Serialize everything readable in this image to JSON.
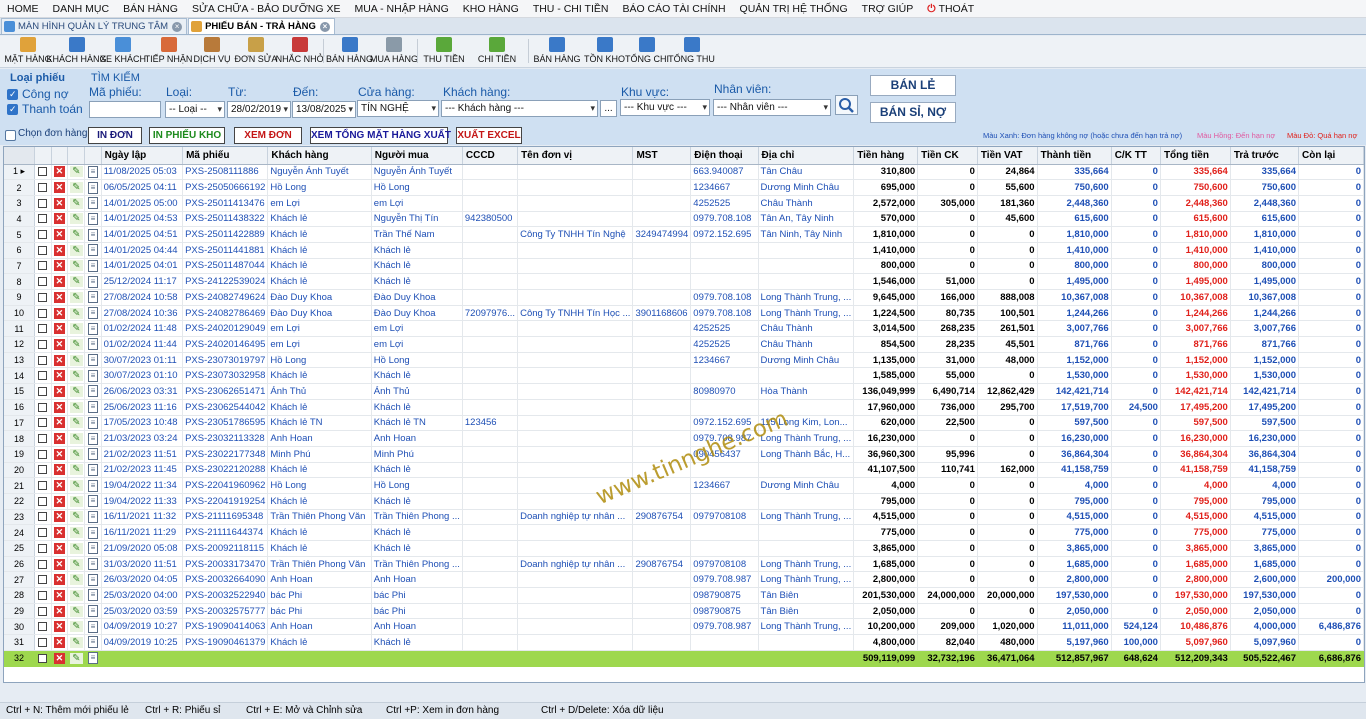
{
  "menu": [
    "HOME",
    "DANH MỤC",
    "BÁN HÀNG",
    "SỬA CHỮA - BẢO DƯỠNG XE",
    "MUA - NHẬP HÀNG",
    "KHO HÀNG",
    "THU - CHI TIỀN",
    "BÁO CÁO TÀI CHÍNH",
    "QUẢN TRỊ HỆ THỐNG",
    "TRỢ GIÚP",
    "THOÁT"
  ],
  "tabs": [
    "MÀN HÌNH QUẢN LÝ TRUNG TÂM",
    "PHIẾU BÁN - TRẢ HÀNG"
  ],
  "toolbar": [
    {
      "label": "MẶT HÀNG",
      "icon": "box-icon"
    },
    {
      "label": "KHÁCH HÀNG",
      "icon": "customer-icon"
    },
    {
      "label": "XE KHÁCH",
      "icon": "car-icon"
    },
    {
      "label": "TIẾP NHẬN",
      "icon": "reception-icon"
    },
    {
      "label": "DỊCH VỤ",
      "icon": "tools-icon"
    },
    {
      "label": "ĐƠN SỬA",
      "icon": "repair-order-icon"
    },
    {
      "label": "NHẮC NHỞ",
      "icon": "reminder-icon"
    },
    {
      "label": "BÁN HÀNG",
      "icon": "sales-icon"
    },
    {
      "label": "MUA HÀNG",
      "icon": "purchase-icon"
    },
    {
      "label": "THU TIỀN",
      "icon": "money-in-icon"
    },
    {
      "label": "CHI TIỀN",
      "icon": "money-out-icon"
    },
    {
      "label": "BÁN HÀNG",
      "icon": "sales-report-icon"
    },
    {
      "label": "TỒN KHO",
      "icon": "inventory-icon"
    },
    {
      "label": "TỔNG CHI",
      "icon": "total-expense-icon"
    },
    {
      "label": "TỔNG THU",
      "icon": "total-income-icon"
    }
  ],
  "filter": {
    "loai_phieu": "Loại phiếu",
    "tim_kiem": "TÌM KIẾM",
    "cong_no": "Công nợ",
    "thanh_toan": "Thanh toán",
    "ma_phieu_label": "Mã phiếu:",
    "loai_label": "Loại:",
    "tu_label": "Từ:",
    "den_label": "Đến:",
    "cua_hang_label": "Cửa hàng:",
    "khach_hang_label": "Khách hàng:",
    "khu_vuc_label": "Khu vực:",
    "nhan_vien_label": "Nhân viên:",
    "loai_value": "-- Loại --",
    "tu_value": "28/02/2019",
    "den_value": "13/08/2025",
    "cua_hang_value": "TÍN NGHỆ",
    "khach_hang_value": "--- Khách hàng ---",
    "khu_vuc_value": "--- Khu vực ---",
    "nhan_vien_value": "--- Nhân viên ---",
    "more_value": "...",
    "ban_le": "BÁN LẺ",
    "ban_si_no": "BÁN SỈ, NỢ",
    "chon_don_hang": "Chọn đơn hàng",
    "in_don": "IN ĐƠN",
    "in_phieu_kho": "IN PHIẾU KHO",
    "xem_don": "XEM ĐƠN",
    "xem_tong": "XEM TỔNG MẶT HÀNG XUẤT",
    "xuat_excel": "XUẤT EXCEL",
    "legend_blue": "Màu Xanh: Đơn hàng không nợ (hoặc chưa đến hạn trả nợ)",
    "legend_pink": "Màu Hồng: Đến hạn nợ",
    "legend_red": "Màu Đỏ: Quá hạn nợ"
  },
  "colors": {
    "blue": "#1e4fb5",
    "red": "#e0201a",
    "pink": "#e05aa0",
    "total": "#9ed84e"
  },
  "columns": [
    "Ngày lập",
    "Mã phiếu",
    "Khách hàng",
    "Người mua",
    "CCCD",
    "Tên đơn vị",
    "MST",
    "Điện thoại",
    "Địa chỉ",
    "Tiền hàng",
    "Tiền CK",
    "Tiền VAT",
    "Thành tiền",
    "C/K TT",
    "Tổng tiền",
    "Trả trước",
    "Còn lại"
  ],
  "rows": [
    [
      "11/08/2025 05:03",
      "PXS-2508111886",
      "Nguyễn Ánh Tuyết",
      "Nguyễn Ánh Tuyết",
      "",
      "",
      "",
      "663.940087",
      "Tân Châu",
      "310,800",
      "0",
      "24,864",
      "335,664",
      "0",
      "335,664",
      "335,664",
      "0"
    ],
    [
      "06/05/2025 04:11",
      "PXS-25050666192",
      "Hồ Long",
      "Hồ Long",
      "",
      "",
      "",
      "1234667",
      "Dương Minh Châu",
      "695,000",
      "0",
      "55,600",
      "750,600",
      "0",
      "750,600",
      "750,600",
      "0"
    ],
    [
      "14/01/2025 05:00",
      "PXS-25011413476",
      "em Lợi",
      "em Lợi",
      "",
      "",
      "",
      "4252525",
      "Châu Thành",
      "2,572,000",
      "305,000",
      "181,360",
      "2,448,360",
      "0",
      "2,448,360",
      "2,448,360",
      "0"
    ],
    [
      "14/01/2025 04:53",
      "PXS-25011438322",
      "Khách lẻ",
      "Nguyễn Thị Tín",
      "942380500",
      "",
      "",
      "0979.708.108",
      "Tân An, Tây Ninh",
      "570,000",
      "0",
      "45,600",
      "615,600",
      "0",
      "615,600",
      "615,600",
      "0"
    ],
    [
      "14/01/2025 04:51",
      "PXS-25011422889",
      "Khách lẻ",
      "Trần Thế Nam",
      "",
      "Công Ty TNHH Tín Nghệ",
      "3249474994",
      "0972.152.695",
      "Tân Ninh, Tây Ninh",
      "1,810,000",
      "0",
      "0",
      "1,810,000",
      "0",
      "1,810,000",
      "1,810,000",
      "0"
    ],
    [
      "14/01/2025 04:44",
      "PXS-25011441881",
      "Khách lẻ",
      "Khách lẻ",
      "",
      "",
      "",
      "",
      "",
      "1,410,000",
      "0",
      "0",
      "1,410,000",
      "0",
      "1,410,000",
      "1,410,000",
      "0"
    ],
    [
      "14/01/2025 04:01",
      "PXS-25011487044",
      "Khách lẻ",
      "Khách lẻ",
      "",
      "",
      "",
      "",
      "",
      "800,000",
      "0",
      "0",
      "800,000",
      "0",
      "800,000",
      "800,000",
      "0"
    ],
    [
      "25/12/2024 11:17",
      "PXS-24122539024",
      "Khách lẻ",
      "Khách lẻ",
      "",
      "",
      "",
      "",
      "",
      "1,546,000",
      "51,000",
      "0",
      "1,495,000",
      "0",
      "1,495,000",
      "1,495,000",
      "0"
    ],
    [
      "27/08/2024 10:58",
      "PXS-24082749624",
      "Đào Duy Khoa",
      "Đào Duy Khoa",
      "",
      "",
      "",
      "0979.708.108",
      "Long Thành Trung, ...",
      "9,645,000",
      "166,000",
      "888,008",
      "10,367,008",
      "0",
      "10,367,008",
      "10,367,008",
      "0"
    ],
    [
      "27/08/2024 10:36",
      "PXS-24082786469",
      "Đào Duy Khoa",
      "Đào Duy Khoa",
      "72097976...",
      "Công Ty TNHH Tín Học ...",
      "3901168606",
      "0979.708.108",
      "Long Thành Trung, ...",
      "1,224,500",
      "80,735",
      "100,501",
      "1,244,266",
      "0",
      "1,244,266",
      "1,244,266",
      "0"
    ],
    [
      "01/02/2024 11:48",
      "PXS-24020129049",
      "em Lợi",
      "em Lợi",
      "",
      "",
      "",
      "4252525",
      "Châu Thành",
      "3,014,500",
      "268,235",
      "261,501",
      "3,007,766",
      "0",
      "3,007,766",
      "3,007,766",
      "0"
    ],
    [
      "01/02/2024 11:44",
      "PXS-24020146495",
      "em Lợi",
      "em Lợi",
      "",
      "",
      "",
      "4252525",
      "Châu Thành",
      "854,500",
      "28,235",
      "45,501",
      "871,766",
      "0",
      "871,766",
      "871,766",
      "0"
    ],
    [
      "30/07/2023 01:11",
      "PXS-23073019797",
      "Hồ Long",
      "Hồ Long",
      "",
      "",
      "",
      "1234667",
      "Dương Minh Châu",
      "1,135,000",
      "31,000",
      "48,000",
      "1,152,000",
      "0",
      "1,152,000",
      "1,152,000",
      "0"
    ],
    [
      "30/07/2023 01:10",
      "PXS-23073032958",
      "Khách lẻ",
      "Khách lẻ",
      "",
      "",
      "",
      "",
      "",
      "1,585,000",
      "55,000",
      "0",
      "1,530,000",
      "0",
      "1,530,000",
      "1,530,000",
      "0"
    ],
    [
      "26/06/2023 03:31",
      "PXS-23062651471",
      "Ánh Thủ",
      "Ánh Thủ",
      "",
      "",
      "",
      "80980970",
      "Hòa Thành",
      "136,049,999",
      "6,490,714",
      "12,862,429",
      "142,421,714",
      "0",
      "142,421,714",
      "142,421,714",
      "0"
    ],
    [
      "25/06/2023 11:16",
      "PXS-23062544042",
      "Khách lẻ",
      "Khách lẻ",
      "",
      "",
      "",
      "",
      "",
      "17,960,000",
      "736,000",
      "295,700",
      "17,519,700",
      "24,500",
      "17,495,200",
      "17,495,200",
      "0"
    ],
    [
      "17/05/2023 10:48",
      "PXS-23051786595",
      "Khách lẻ TN",
      "Khách lẻ TN",
      "123456",
      "",
      "",
      "0972.152.695",
      "115 Long Kim, Lon...",
      "620,000",
      "22,500",
      "0",
      "597,500",
      "0",
      "597,500",
      "597,500",
      "0"
    ],
    [
      "21/03/2023 03:24",
      "PXS-23032113328",
      "Anh Hoan",
      "Anh Hoan",
      "",
      "",
      "",
      "0979.708.987",
      "Long Thành Trung, ...",
      "16,230,000",
      "0",
      "0",
      "16,230,000",
      "0",
      "16,230,000",
      "16,230,000",
      "0"
    ],
    [
      "21/02/2023 11:51",
      "PXS-23022177348",
      "Minh Phú",
      "Minh Phú",
      "",
      "",
      "",
      "090456437",
      "Long Thành Bắc, H...",
      "36,960,300",
      "95,996",
      "0",
      "36,864,304",
      "0",
      "36,864,304",
      "36,864,304",
      "0"
    ],
    [
      "21/02/2023 11:45",
      "PXS-23022120288",
      "Khách lẻ",
      "Khách lẻ",
      "",
      "",
      "",
      "",
      "",
      "41,107,500",
      "110,741",
      "162,000",
      "41,158,759",
      "0",
      "41,158,759",
      "41,158,759",
      "0"
    ],
    [
      "19/04/2022 11:34",
      "PXS-22041960962",
      "Hồ Long",
      "Hồ Long",
      "",
      "",
      "",
      "1234667",
      "Dương Minh Châu",
      "4,000",
      "0",
      "0",
      "4,000",
      "0",
      "4,000",
      "4,000",
      "0"
    ],
    [
      "19/04/2022 11:33",
      "PXS-22041919254",
      "Khách lẻ",
      "Khách lẻ",
      "",
      "",
      "",
      "",
      "",
      "795,000",
      "0",
      "0",
      "795,000",
      "0",
      "795,000",
      "795,000",
      "0"
    ],
    [
      "16/11/2021 11:32",
      "PXS-21111695348",
      "Trần Thiên Phong Văn",
      "Trần Thiên Phong ...",
      "",
      "Doanh nghiệp tự nhân ...",
      "290876754",
      "0979708108",
      "Long Thành Trung, ...",
      "4,515,000",
      "0",
      "0",
      "4,515,000",
      "0",
      "4,515,000",
      "4,515,000",
      "0"
    ],
    [
      "16/11/2021 11:29",
      "PXS-21111644374",
      "Khách lẻ",
      "Khách lẻ",
      "",
      "",
      "",
      "",
      "",
      "775,000",
      "0",
      "0",
      "775,000",
      "0",
      "775,000",
      "775,000",
      "0"
    ],
    [
      "21/09/2020 05:08",
      "PXS-20092118115",
      "Khách lẻ",
      "Khách lẻ",
      "",
      "",
      "",
      "",
      "",
      "3,865,000",
      "0",
      "0",
      "3,865,000",
      "0",
      "3,865,000",
      "3,865,000",
      "0"
    ],
    [
      "31/03/2020 11:51",
      "PXS-20033173470",
      "Trần Thiên Phong Văn",
      "Trần Thiên Phong ...",
      "",
      "Doanh nghiệp tự nhân ...",
      "290876754",
      "0979708108",
      "Long Thành Trung, ...",
      "1,685,000",
      "0",
      "0",
      "1,685,000",
      "0",
      "1,685,000",
      "1,685,000",
      "0"
    ],
    [
      "26/03/2020 04:05",
      "PXS-20032664090",
      "Anh Hoan",
      "Anh Hoan",
      "",
      "",
      "",
      "0979.708.987",
      "Long Thành Trung, ...",
      "2,800,000",
      "0",
      "0",
      "2,800,000",
      "0",
      "2,800,000",
      "2,600,000",
      "200,000"
    ],
    [
      "25/03/2020 04:00",
      "PXS-20032522940",
      "bác Phi",
      "bác Phi",
      "",
      "",
      "",
      "098790875",
      "Tân Biên",
      "201,530,000",
      "24,000,000",
      "20,000,000",
      "197,530,000",
      "0",
      "197,530,000",
      "197,530,000",
      "0"
    ],
    [
      "25/03/2020 03:59",
      "PXS-20032575777",
      "bác Phi",
      "bác Phi",
      "",
      "",
      "",
      "098790875",
      "Tân Biên",
      "2,050,000",
      "0",
      "0",
      "2,050,000",
      "0",
      "2,050,000",
      "2,050,000",
      "0"
    ],
    [
      "04/09/2019 10:27",
      "PXS-19090414063",
      "Anh Hoan",
      "Anh Hoan",
      "",
      "",
      "",
      "0979.708.987",
      "Long Thành Trung, ...",
      "10,200,000",
      "209,000",
      "1,020,000",
      "11,011,000",
      "524,124",
      "10,486,876",
      "4,000,000",
      "6,486,876"
    ],
    [
      "04/09/2019 10:25",
      "PXS-19090461379",
      "Khách lẻ",
      "Khách lẻ",
      "",
      "",
      "",
      "",
      "",
      "4,800,000",
      "82,040",
      "480,000",
      "5,197,960",
      "100,000",
      "5,097,960",
      "5,097,960",
      "0"
    ]
  ],
  "totals": [
    "509,119,099",
    "32,732,196",
    "36,471,064",
    "512,857,967",
    "648,624",
    "512,209,343",
    "505,522,467",
    "6,686,876"
  ],
  "total_row_number": "32",
  "watermark": "www.tinnghe.com",
  "status": [
    "Ctrl + N: Thêm mới phiếu lẻ",
    "Ctrl + R: Phiếu sỉ",
    "Ctrl + E: Mở và Chỉnh sửa",
    "Ctrl +P: Xem in đơn hàng",
    "Ctrl + D/Delete: Xóa dữ liệu"
  ]
}
